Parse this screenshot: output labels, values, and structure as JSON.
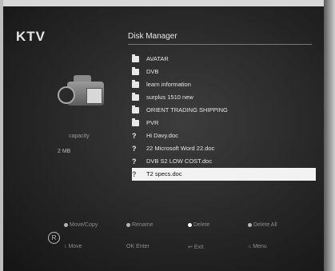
{
  "brand": "KTV",
  "title": "Disk Manager",
  "capacity_label": "capacity",
  "capacity_value": "2 MB",
  "files": [
    {
      "type": "folder",
      "name": "AVATAR",
      "selected": false
    },
    {
      "type": "folder",
      "name": "DVB",
      "selected": false
    },
    {
      "type": "folder",
      "name": "learn information",
      "selected": false
    },
    {
      "type": "folder",
      "name": "surplus 1510 new",
      "selected": false
    },
    {
      "type": "folder",
      "name": "ORIENT TRADING SHIPPING",
      "selected": false
    },
    {
      "type": "folder",
      "name": "PVR",
      "selected": false
    },
    {
      "type": "unknown",
      "name": "Hi Davy.doc",
      "selected": false
    },
    {
      "type": "unknown",
      "name": "22 Microsoft Word 22.doc",
      "selected": false
    },
    {
      "type": "unknown",
      "name": "DVB S2 LOW COST.doc",
      "selected": false
    },
    {
      "type": "unknown",
      "name": "T2 specs.doc",
      "selected": true
    }
  ],
  "hints_top": [
    "Move/Copy",
    "Rename",
    "Delete",
    "Delete All"
  ],
  "hints_bottom": [
    "Move",
    "Enter",
    "Exit",
    "Menu"
  ],
  "icons": {
    "folder": "folder-icon",
    "unknown": "question-icon",
    "camera": "camcorder-icon"
  }
}
